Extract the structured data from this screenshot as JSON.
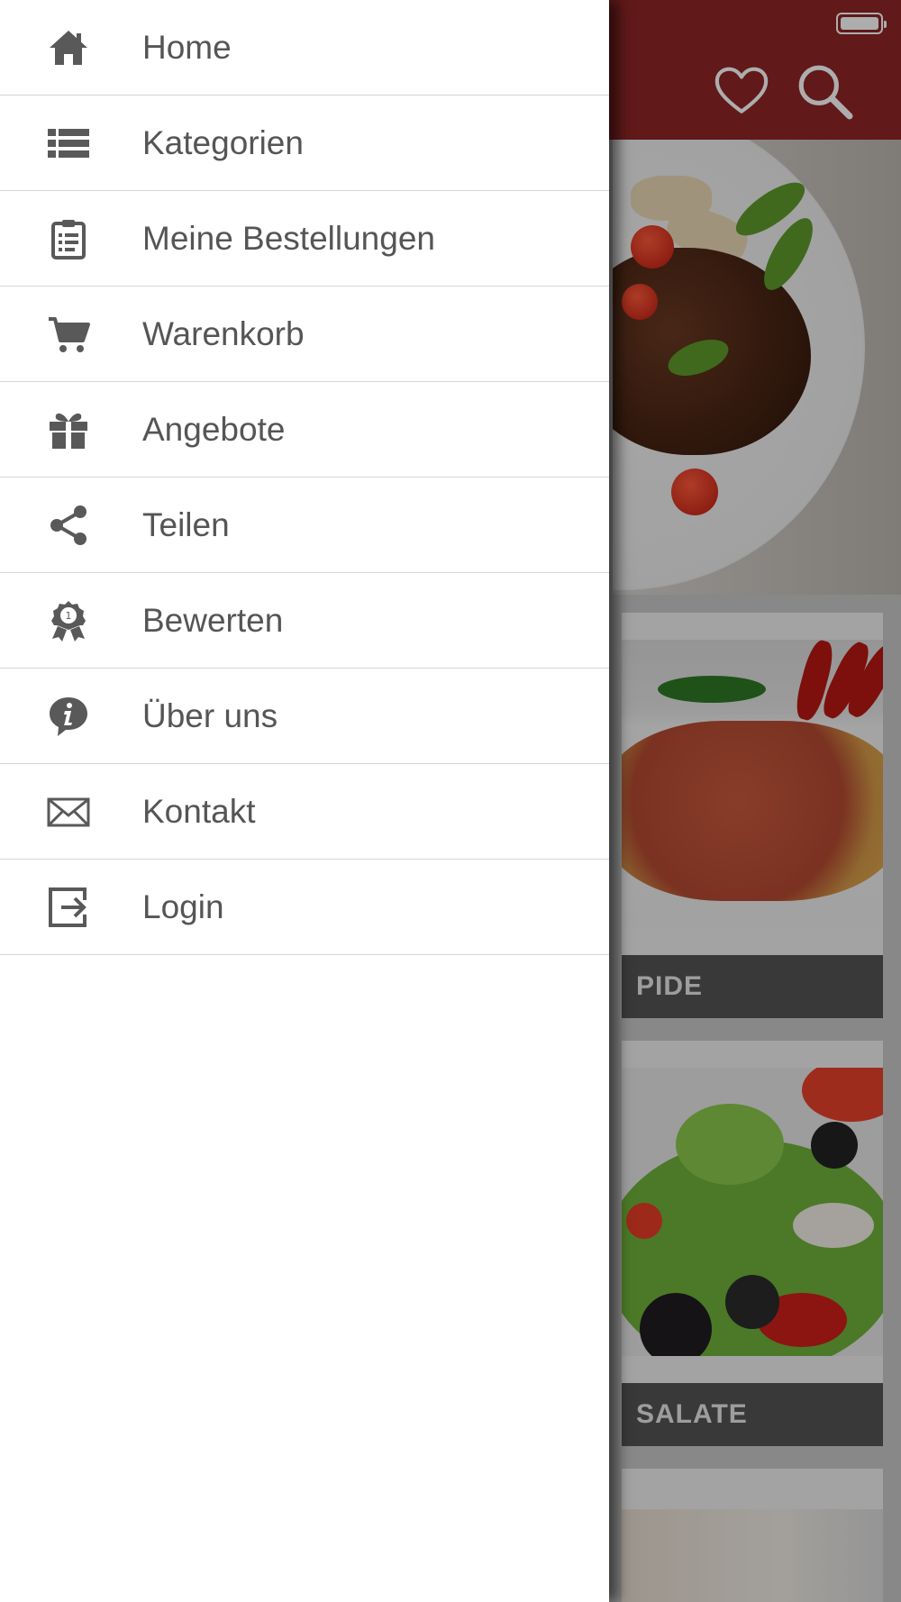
{
  "status_bar": {
    "battery_icon": "battery-full-icon"
  },
  "app_bar": {
    "color": "#8f2526",
    "actions": [
      {
        "name": "favorites",
        "icon": "heart-icon"
      },
      {
        "name": "search",
        "icon": "search-icon"
      }
    ]
  },
  "categories": [
    {
      "label": "PIDE"
    },
    {
      "label": "SALATE"
    }
  ],
  "drawer": {
    "items": [
      {
        "label": "Home",
        "icon": "home-icon"
      },
      {
        "label": "Kategorien",
        "icon": "list-icon"
      },
      {
        "label": "Meine Bestellungen",
        "icon": "clipboard-icon"
      },
      {
        "label": "Warenkorb",
        "icon": "cart-icon"
      },
      {
        "label": "Angebote",
        "icon": "gift-icon"
      },
      {
        "label": "Teilen",
        "icon": "share-icon"
      },
      {
        "label": "Bewerten",
        "icon": "award-icon"
      },
      {
        "label": "Über uns",
        "icon": "info-icon"
      },
      {
        "label": "Kontakt",
        "icon": "mail-icon"
      },
      {
        "label": "Login",
        "icon": "login-icon"
      }
    ]
  }
}
